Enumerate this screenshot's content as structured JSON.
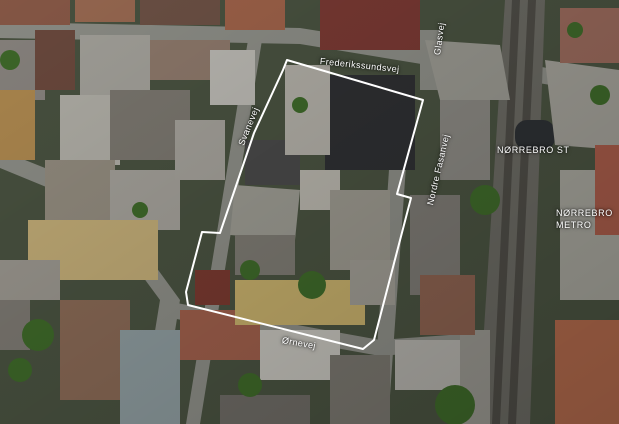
{
  "map": {
    "streets": {
      "frederikssundsvej": "Frederikssundsvej",
      "svanevej": "Svanevej",
      "nordre_fasanvej": "Nordre Fasanvej",
      "ornevej": "Ørnevej",
      "glasvej": "Glasvej"
    },
    "places": {
      "norrebro_st": "NØRREBRO ST",
      "norrebro_metro": "NØRREBRO\nMETRO"
    },
    "colors": {
      "outline": "#ffffff",
      "label": "#ffffff"
    }
  }
}
